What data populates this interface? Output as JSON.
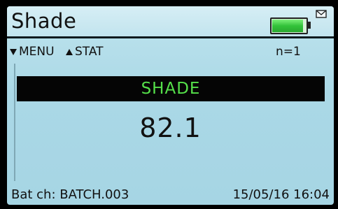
{
  "header": {
    "title": "Shade",
    "battery_level": 0.95,
    "battery_color": "#33c23a"
  },
  "nav": {
    "menu_label": "MENU",
    "menu_icon": "triangle-down-icon",
    "stat_label": "STAT",
    "stat_icon": "triangle-up-icon",
    "count": "n=1"
  },
  "measurement": {
    "label": "SHADE",
    "label_color": "#55e04a",
    "value": "82.1"
  },
  "footer": {
    "batch": "Bat ch: BATCH.003",
    "datetime": "15/05/16 16:04"
  },
  "icons": {
    "status_icon": "envelope-icon"
  }
}
